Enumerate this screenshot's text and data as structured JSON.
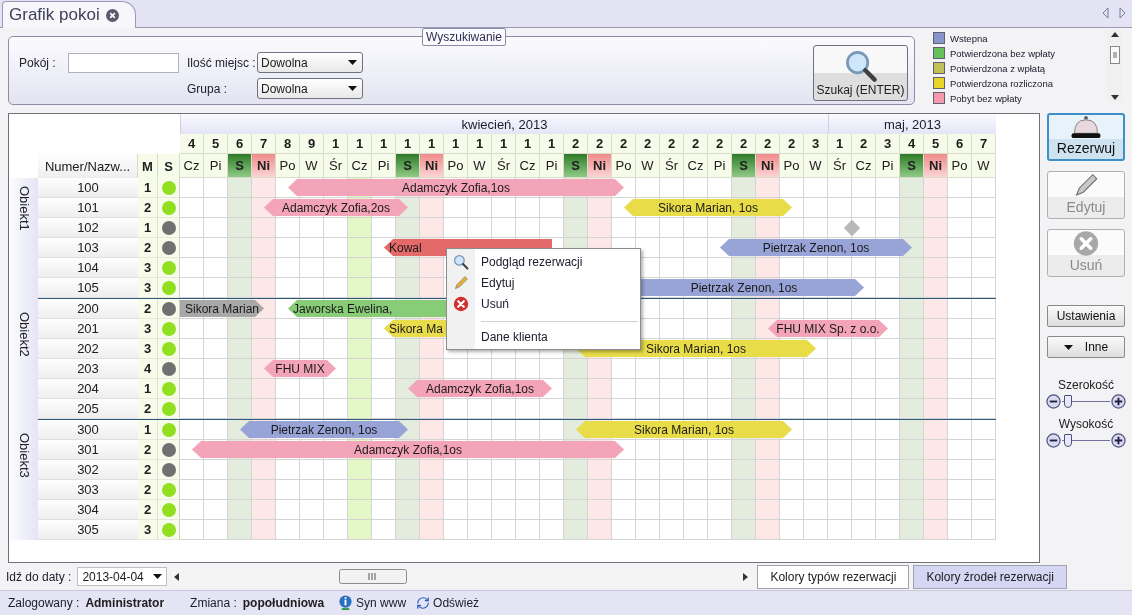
{
  "tab": {
    "title": "Grafik pokoi"
  },
  "search": {
    "title": "Wyszukiwanie",
    "room": {
      "label": "Pokój :"
    },
    "seats": {
      "label": "Ilość miejsc :",
      "value": "Dowolna"
    },
    "group": {
      "label": "Grupa :",
      "value": "Dowolna"
    },
    "button": "Szukaj (ENTER)"
  },
  "legend": [
    {
      "label": "Wstepna",
      "color": "#8896cc"
    },
    {
      "label": "Potwierdzona bez wpłaty",
      "color": "#66c05c"
    },
    {
      "label": "Potwierdzona z wpłatą",
      "color": "#c0c058"
    },
    {
      "label": "Potwierdzona rozliczona",
      "color": "#e8d428"
    },
    {
      "label": "Pobyt bez wpłaty",
      "color": "#f49aac"
    }
  ],
  "grid": {
    "header": {
      "name": "Numer/Nazw...",
      "m": "M",
      "s": "S"
    },
    "months": [
      {
        "label": "kwiecień, 2013",
        "days": [
          {
            "num": "4",
            "weekday": "Cz",
            "kind": "weekday",
            "today": false
          },
          {
            "num": "5",
            "weekday": "Pi",
            "kind": "weekday",
            "today": false
          },
          {
            "num": "6",
            "weekday": "S",
            "kind": "saturday",
            "today": false
          },
          {
            "num": "7",
            "weekday": "Ni",
            "kind": "sunday",
            "today": false
          },
          {
            "num": "8",
            "weekday": "Po",
            "kind": "weekday",
            "today": false
          },
          {
            "num": "9",
            "weekday": "W",
            "kind": "weekday",
            "today": false
          },
          {
            "num": "1",
            "weekday": "Śr",
            "kind": "weekday",
            "today": false
          },
          {
            "num": "1",
            "weekday": "Cz",
            "kind": "weekday",
            "today": true
          },
          {
            "num": "1",
            "weekday": "Pi",
            "kind": "weekday",
            "today": false
          },
          {
            "num": "1",
            "weekday": "S",
            "kind": "saturday",
            "today": false
          },
          {
            "num": "1",
            "weekday": "Ni",
            "kind": "sunday",
            "today": false
          },
          {
            "num": "1",
            "weekday": "Po",
            "kind": "weekday",
            "today": false
          },
          {
            "num": "1",
            "weekday": "W",
            "kind": "weekday",
            "today": false
          },
          {
            "num": "1",
            "weekday": "Śr",
            "kind": "weekday",
            "today": false
          },
          {
            "num": "1",
            "weekday": "Cz",
            "kind": "weekday",
            "today": false
          },
          {
            "num": "1",
            "weekday": "Pi",
            "kind": "weekday",
            "today": false
          },
          {
            "num": "2",
            "weekday": "S",
            "kind": "saturday",
            "today": false
          },
          {
            "num": "2",
            "weekday": "Ni",
            "kind": "sunday",
            "today": false
          },
          {
            "num": "2",
            "weekday": "Po",
            "kind": "weekday",
            "today": false
          },
          {
            "num": "2",
            "weekday": "W",
            "kind": "weekday",
            "today": false
          },
          {
            "num": "2",
            "weekday": "Śr",
            "kind": "weekday",
            "today": false
          },
          {
            "num": "2",
            "weekday": "Cz",
            "kind": "weekday",
            "today": false
          },
          {
            "num": "2",
            "weekday": "Pi",
            "kind": "weekday",
            "today": false
          },
          {
            "num": "2",
            "weekday": "S",
            "kind": "saturday",
            "today": false
          },
          {
            "num": "2",
            "weekday": "Ni",
            "kind": "sunday",
            "today": false
          },
          {
            "num": "2",
            "weekday": "Po",
            "kind": "weekday",
            "today": false
          },
          {
            "num": "3",
            "weekday": "W",
            "kind": "weekday",
            "today": false
          }
        ]
      },
      {
        "label": "maj, 2013",
        "days": [
          {
            "num": "1",
            "weekday": "Śr",
            "kind": "weekday",
            "today": false
          },
          {
            "num": "2",
            "weekday": "Cz",
            "kind": "weekday",
            "today": false
          },
          {
            "num": "3",
            "weekday": "Pi",
            "kind": "weekday",
            "today": false
          },
          {
            "num": "4",
            "weekday": "S",
            "kind": "saturday",
            "today": false
          },
          {
            "num": "5",
            "weekday": "Ni",
            "kind": "sunday",
            "today": false
          },
          {
            "num": "6",
            "weekday": "Po",
            "kind": "weekday",
            "today": false
          },
          {
            "num": "7",
            "weekday": "W",
            "kind": "weekday",
            "today": false
          }
        ]
      }
    ],
    "groups": [
      {
        "label": "Obiekt1",
        "rooms": [
          {
            "number": "100",
            "m": "1",
            "color": "#90e020",
            "bookings": [
              {
                "label": "Adamczyk Zofia,1os",
                "color": "#f4a4b8",
                "covered": false
              }
            ]
          },
          {
            "number": "101",
            "m": "2",
            "color": "#90e020",
            "bookings": [
              {
                "label": "Adamczyk Zofia,2os",
                "color": "#f4a4b8",
                "covered": false
              },
              {
                "label": "Sikora Marian, 1os",
                "color": "#e8dc48",
                "covered": false
              }
            ]
          },
          {
            "number": "102",
            "m": "1",
            "color": "#707070"
          },
          {
            "number": "103",
            "m": "2",
            "color": "#707070",
            "bookings": [
              {
                "label": "Kowal",
                "color": "#e46a6a",
                "covered": true
              },
              {
                "label": "Pietrzak Zenon, 1os",
                "color": "#98a4d8",
                "covered": false
              }
            ]
          },
          {
            "number": "104",
            "m": "3",
            "color": "#90e020"
          },
          {
            "number": "105",
            "m": "3",
            "color": "#90e020",
            "bookings": [
              {
                "label": "Pietrzak Zenon, 1os",
                "color": "#98a4d8",
                "covered": false
              }
            ]
          }
        ]
      },
      {
        "label": "Obiekt2",
        "rooms": [
          {
            "number": "200",
            "m": "2",
            "color": "#707070",
            "bookings": [
              {
                "label": "Sikora Marian",
                "color": "#a8a8a8",
                "covered": false
              },
              {
                "label": "Jaworska Ewelina,",
                "color": "#88cc78",
                "covered": true
              }
            ]
          },
          {
            "number": "201",
            "m": "3",
            "color": "#90e020",
            "bookings": [
              {
                "label": "Sikora Ma",
                "color": "#e8dc48",
                "covered": true
              },
              {
                "label": "FHU MIX Sp. z o.o.",
                "color": "#f4a4b8",
                "covered": false
              }
            ]
          },
          {
            "number": "202",
            "m": "3",
            "color": "#90e020",
            "bookings": [
              {
                "label": "Sikora Marian, 1os",
                "color": "#e8dc48",
                "covered": false
              }
            ]
          },
          {
            "number": "203",
            "m": "4",
            "color": "#707070",
            "bookings": [
              {
                "label": "FHU MIX",
                "color": "#f4a4b8",
                "covered": false
              }
            ]
          },
          {
            "number": "204",
            "m": "1",
            "color": "#90e020",
            "bookings": [
              {
                "label": "Adamczyk Zofia,1os",
                "color": "#f4a4b8",
                "covered": false
              }
            ]
          },
          {
            "number": "205",
            "m": "2",
            "color": "#90e020"
          }
        ]
      },
      {
        "label": "Obiekt3",
        "rooms": [
          {
            "number": "300",
            "m": "1",
            "color": "#90e020",
            "bookings": [
              {
                "label": "Pietrzak Zenon, 1os",
                "color": "#98a4d8",
                "covered": false
              },
              {
                "label": "Sikora Marian, 1os",
                "color": "#e8dc48",
                "covered": false
              }
            ]
          },
          {
            "number": "301",
            "m": "2",
            "color": "#707070",
            "bookings": [
              {
                "label": "Adamczyk Zofia,1os",
                "color": "#f4a4b8",
                "covered": false
              }
            ]
          },
          {
            "number": "302",
            "m": "2",
            "color": "#707070"
          },
          {
            "number": "303",
            "m": "2",
            "color": "#90e020"
          },
          {
            "number": "304",
            "m": "2",
            "color": "#90e020"
          },
          {
            "number": "305",
            "m": "3",
            "color": "#90e020"
          }
        ]
      }
    ]
  },
  "context_menu": [
    {
      "label": "Podgląd rezerwacji",
      "separator_before": false
    },
    {
      "label": "Edytuj",
      "separator_before": false
    },
    {
      "label": "Usuń",
      "separator_before": false
    },
    {
      "label": "Dane klienta",
      "separator_before": true
    }
  ],
  "actions": [
    {
      "label": "Rezerwuj",
      "disabled": false,
      "focused": true
    },
    {
      "label": "Edytuj",
      "disabled": true,
      "focused": false
    },
    {
      "label": "Usuń",
      "disabled": true,
      "focused": false
    }
  ],
  "settings_button": "Ustawienia",
  "more_button": "Inne",
  "sliders": [
    {
      "label": "Szerokość",
      "level": 0.12
    },
    {
      "label": "Wysokość",
      "level": 0.12
    }
  ],
  "goto_date": {
    "label": "Idź do daty :",
    "value": "2013-04-04"
  },
  "color_tabs": [
    {
      "label": "Kolory typów rezerwacji",
      "selected": true
    },
    {
      "label": "Kolory źrodeł rezerwacji",
      "selected": false
    }
  ],
  "status_bar": {
    "user_label": "Zalogowany :",
    "user": "Administrator",
    "shift_label": "Zmiana :",
    "shift": "popołudniowa",
    "links": [
      "Syn www",
      "Odśwież"
    ]
  }
}
